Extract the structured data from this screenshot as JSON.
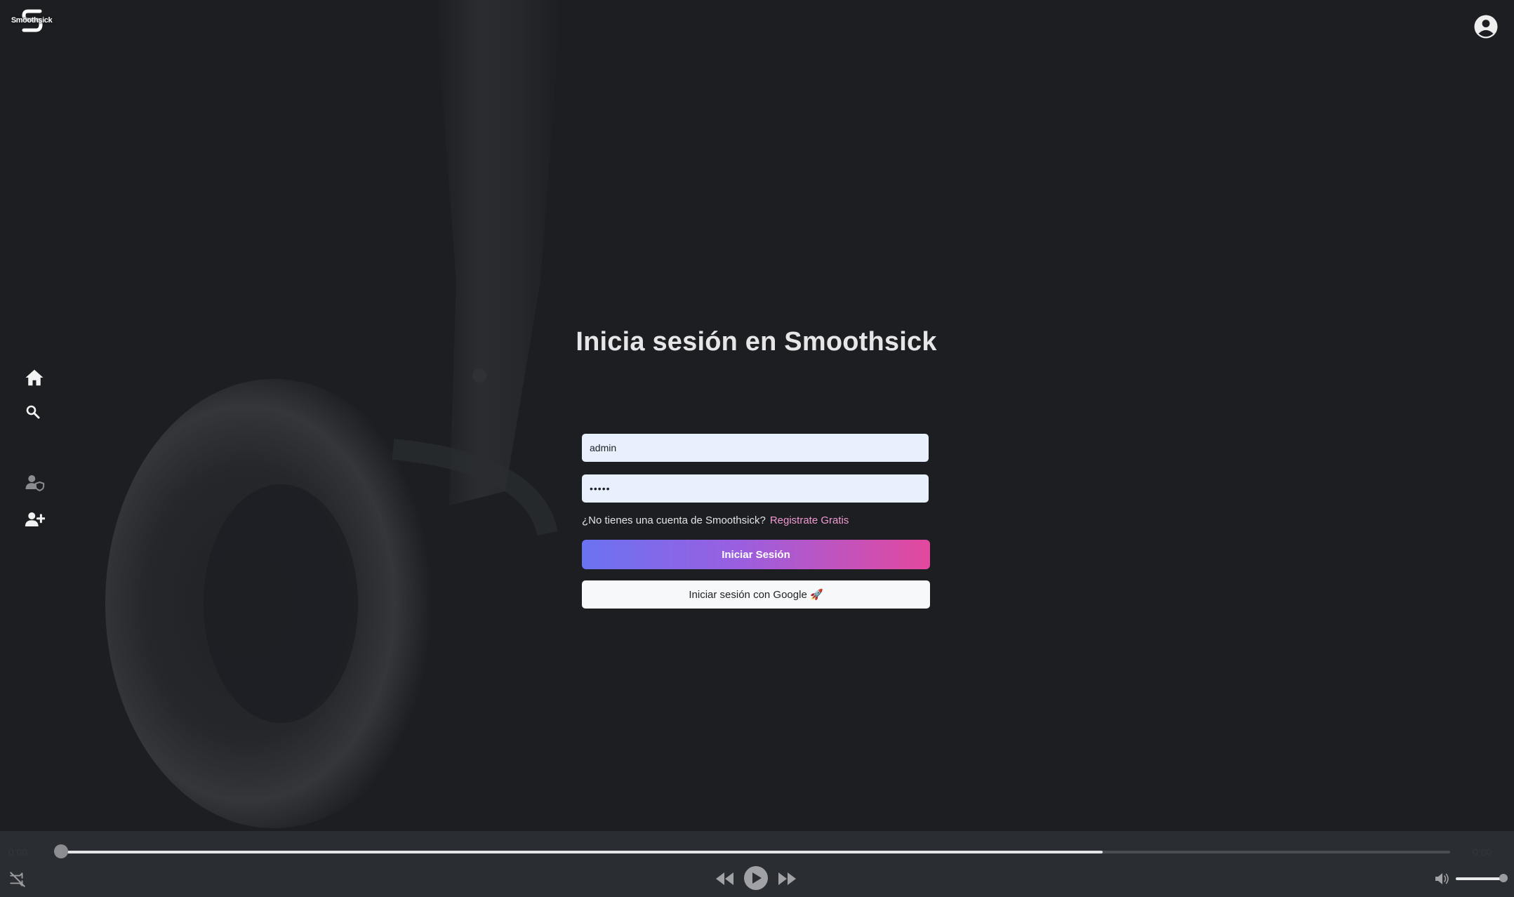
{
  "app": {
    "brand": "Smoothsick"
  },
  "login": {
    "title": "Inicia sesión en Smoothsick",
    "username_value": "admin",
    "password_value": "•••••",
    "signup_prompt": "¿No tienes una cuenta de Smoothsick?",
    "signup_link": "Registrate Gratis",
    "submit_label": "Iniciar Sesión",
    "google_label": "Iniciar sesión con Google 🚀"
  },
  "sidebar": {
    "items": [
      {
        "icon": "home-icon"
      },
      {
        "icon": "search-icon"
      },
      {
        "icon": "user-shield-icon"
      },
      {
        "icon": "user-plus-icon"
      }
    ]
  },
  "player": {
    "current_time": "0:00",
    "total_time": "0:00",
    "progress": 0,
    "buffered": 0.75,
    "volume": 0.9
  },
  "colors": {
    "background": "#1c1e22",
    "player_bg": "#2a2d32",
    "accent_start": "#6b73f2",
    "accent_end": "#e4489e",
    "link": "#f09ad2",
    "input_bg": "#e8f0fe"
  }
}
